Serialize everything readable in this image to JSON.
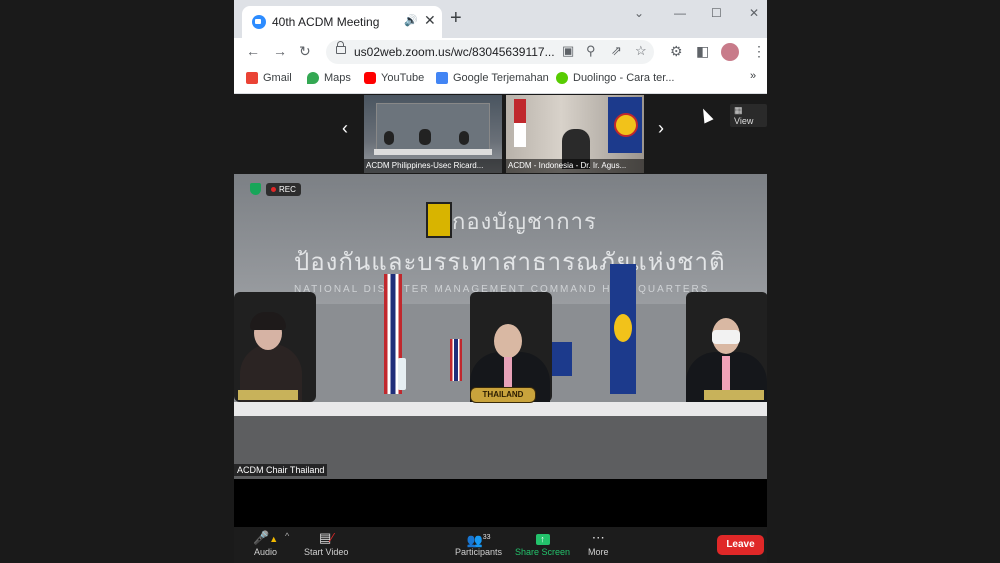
{
  "browser": {
    "tab_title": "40th ACDM Meeting",
    "url": "us02web.zoom.us/wc/83045639117...",
    "bookmarks": [
      {
        "label": "Gmail",
        "icon": "gmail-icon",
        "color": "#ea4335"
      },
      {
        "label": "Maps",
        "icon": "maps-icon",
        "color": "#34a853"
      },
      {
        "label": "YouTube",
        "icon": "youtube-icon",
        "color": "#ff0000"
      },
      {
        "label": "Google Terjemahan",
        "icon": "translate-icon",
        "color": "#4285f4"
      },
      {
        "label": "Duolingo - Cara ter...",
        "icon": "duolingo-icon",
        "color": "#58cc02"
      }
    ]
  },
  "zoom": {
    "view_label": "View",
    "rec_label": "REC",
    "thumbnails": [
      {
        "label": "ACDM Philippines-Usec Ricard..."
      },
      {
        "label": "ACDM - Indonesia - Dr. Ir. Agus..."
      }
    ],
    "main_speaker": "ACDM Chair Thailand",
    "scene": {
      "thai_line1": "กองบัญชาการ",
      "thai_line2": "ป้องกันและบรรเทาสาธารณภัยแห่งชาติ",
      "english_line": "NATIONAL DISASTER MANAGEMENT COMMAND HEADQUARTERS",
      "nameplate": "THAILAND"
    },
    "controls": {
      "audio": "Audio",
      "start_video": "Start Video",
      "participants": "Participants",
      "participants_count": "33",
      "share_screen": "Share Screen",
      "more": "More",
      "leave": "Leave"
    }
  }
}
